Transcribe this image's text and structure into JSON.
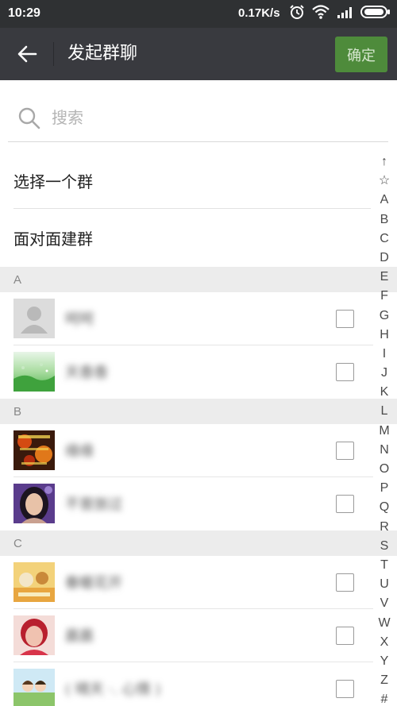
{
  "status_bar": {
    "time": "10:29",
    "network_speed": "0.17K/s",
    "icons": [
      "alarm-icon",
      "wifi-icon",
      "signal-icon",
      "battery-icon"
    ]
  },
  "header": {
    "title": "发起群聊",
    "confirm_label": "确定",
    "back_icon": "back-arrow-icon"
  },
  "search": {
    "placeholder": "搜索",
    "value": ""
  },
  "actions": [
    {
      "label": "选择一个群"
    },
    {
      "label": "面对面建群"
    }
  ],
  "sections": [
    {
      "letter": "A",
      "contacts": [
        {
          "name": "呵呵",
          "avatar": "default-avatar",
          "checked": false
        },
        {
          "name": "天香香",
          "avatar": "green-landscape-avatar",
          "checked": false
        }
      ]
    },
    {
      "letter": "B",
      "contacts": [
        {
          "name": "缘缘",
          "avatar": "flower-text-avatar",
          "checked": false
        },
        {
          "name": "不曾放过",
          "avatar": "woman-portrait-avatar",
          "checked": false
        }
      ]
    },
    {
      "letter": "C",
      "contacts": [
        {
          "name": "春暖花开",
          "avatar": "cartoon-avatar",
          "checked": false
        },
        {
          "name": "晨晨",
          "avatar": "woman-red-hair-avatar",
          "checked": false
        },
        {
          "name": "( 晴天 ·. 心情 )",
          "avatar": "cartoon-kids-avatar",
          "checked": false
        }
      ]
    }
  ],
  "index_bar": [
    "↑",
    "☆",
    "A",
    "B",
    "C",
    "D",
    "E",
    "F",
    "G",
    "H",
    "I",
    "J",
    "K",
    "L",
    "M",
    "N",
    "O",
    "P",
    "Q",
    "R",
    "S",
    "T",
    "U",
    "V",
    "W",
    "X",
    "Y",
    "Z",
    "#"
  ],
  "colors": {
    "header_bg": "#393a3f",
    "status_bg": "#2f3133",
    "confirm_bg": "#4e8b3b",
    "section_bg": "#ececec"
  }
}
